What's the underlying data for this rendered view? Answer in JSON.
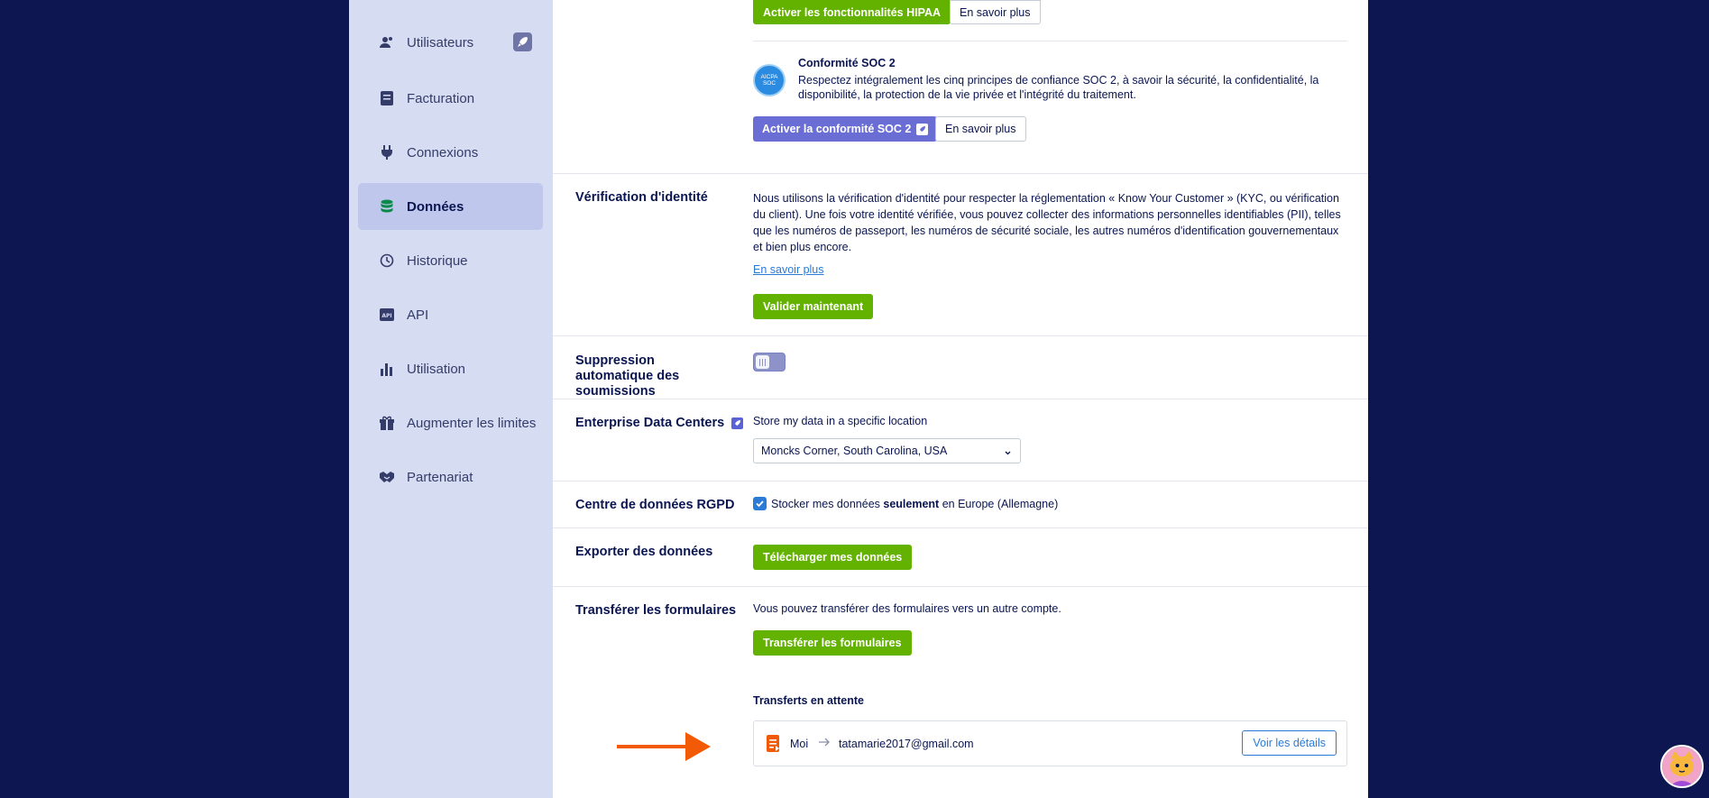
{
  "sidebar": {
    "items": [
      {
        "label": "Utilisateurs",
        "icon": "users-icon"
      },
      {
        "label": "Facturation",
        "icon": "billing-icon"
      },
      {
        "label": "Connexions",
        "icon": "plug-icon"
      },
      {
        "label": "Données",
        "icon": "database-icon",
        "active": true
      },
      {
        "label": "Historique",
        "icon": "history-icon"
      },
      {
        "label": "API",
        "icon": "api-icon"
      },
      {
        "label": "Utilisation",
        "icon": "bar-chart-icon"
      },
      {
        "label": "Augmenter les limites",
        "icon": "gift-icon"
      },
      {
        "label": "Partenariat",
        "icon": "handshake-icon"
      }
    ]
  },
  "hipaa": {
    "activate_label": "Activer les fonctionnalités HIPAA",
    "learn_more_label": "En savoir plus"
  },
  "soc2": {
    "badge_line1": "AICPA",
    "badge_line2": "SOC",
    "title": "Conformité SOC 2",
    "description": "Respectez intégralement les cinq principes de confiance SOC 2, à savoir la sécurité, la confidentialité, la disponibilité, la protection de la vie privée et l'intégrité du traitement.",
    "activate_label": "Activer la conformité SOC 2",
    "learn_more_label": "En savoir plus"
  },
  "identity": {
    "label": "Vérification d'identité",
    "description": "Nous utilisons la vérification d'identité pour respecter la réglementation « Know Your Customer » (KYC, ou vérification du client). Une fois votre identité vérifiée, vous pouvez collecter des informations personnelles identifiables (PII), telles que les numéros de passeport, les numéros de sécurité sociale, les autres numéros d'identification gouvernementaux et bien plus encore.",
    "learn_more_link": "En savoir plus",
    "validate_label": "Valider maintenant"
  },
  "auto_delete": {
    "label": "Suppression automatique des soumissions",
    "enabled": false
  },
  "enterprise_dc": {
    "label": "Enterprise Data Centers",
    "description": "Store my data in a specific location",
    "selected_location": "Moncks Corner, South Carolina, USA"
  },
  "gdpr": {
    "label": "Centre de données RGPD",
    "checkbox_prefix": "Stocker mes données ",
    "checkbox_bold": "seulement",
    "checkbox_suffix": " en Europe (Allemagne)",
    "checked": true
  },
  "export": {
    "label": "Exporter des données",
    "download_label": "Télécharger mes données"
  },
  "transfer": {
    "label": "Transférer les formulaires",
    "description": "Vous pouvez transférer des formulaires vers un autre compte.",
    "transfer_button": "Transférer les formulaires",
    "pending_title": "Transferts en attente",
    "pending": {
      "from": "Moi",
      "to": "tatamarie2017@gmail.com",
      "details_label": "Voir les détails"
    }
  },
  "colors": {
    "green": "#64b200",
    "purple": "#6a6ed4",
    "link_blue": "#2b7bd6",
    "arrow_orange": "#f25a06",
    "navy": "#0a1551"
  }
}
